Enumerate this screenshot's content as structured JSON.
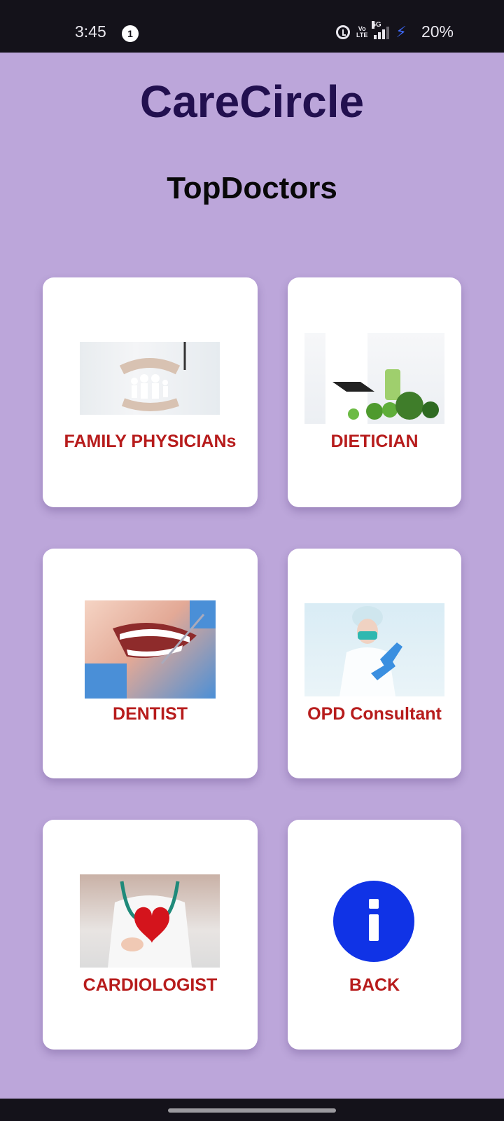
{
  "status_bar": {
    "time": "3:45",
    "notification_count": "1",
    "volte_label": "Vo\nLTE",
    "network_label": "5G",
    "battery": "20%"
  },
  "app_title": "CareCircle",
  "page_title": "TopDoctors",
  "colors": {
    "background": "#bca6da",
    "title": "#22104f",
    "label": "#b71c1c",
    "info_icon": "#1033e6"
  },
  "cards": [
    {
      "label": "FAMILY PHYSICIANs",
      "image": "family-physician-photo"
    },
    {
      "label": "DIETICIAN",
      "image": "dietician-photo"
    },
    {
      "label": "DENTIST",
      "image": "dentist-photo"
    },
    {
      "label": "OPD Consultant",
      "image": "opd-consultant-photo"
    },
    {
      "label": "CARDIOLOGIST",
      "image": "cardiologist-photo"
    },
    {
      "label": "BACK",
      "image": "info-icon"
    }
  ]
}
